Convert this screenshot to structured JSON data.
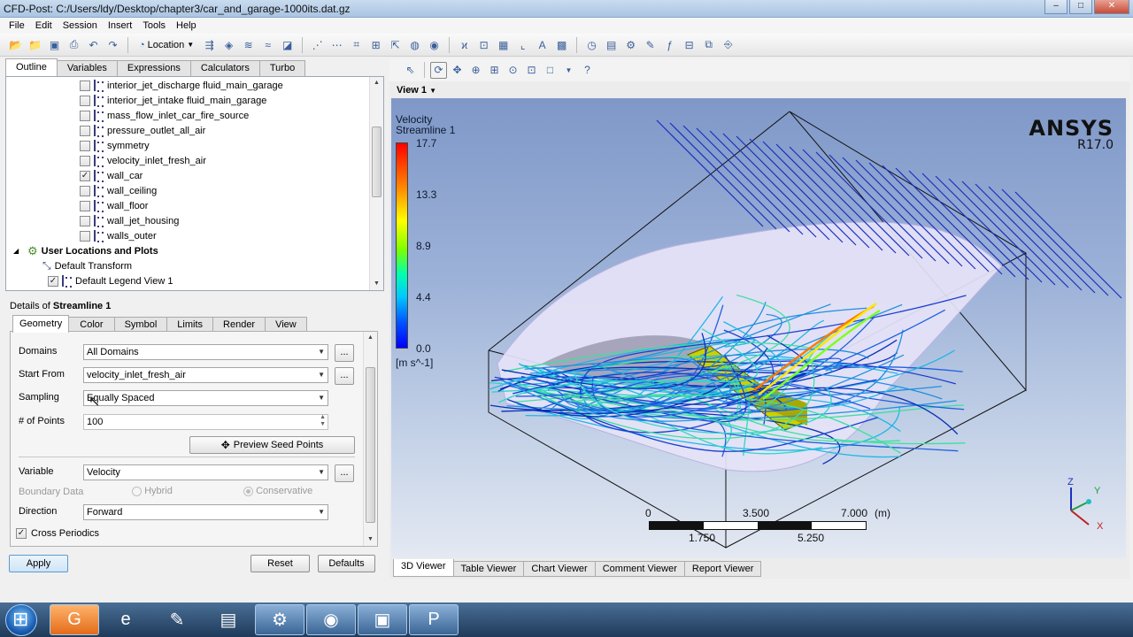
{
  "window": {
    "title": "CFD-Post: C:/Users/ldy/Desktop/chapter3/car_and_garage-1000its.dat.gz"
  },
  "menu": [
    "File",
    "Edit",
    "Session",
    "Insert",
    "Tools",
    "Help"
  ],
  "toolbar": {
    "location_label": "Location"
  },
  "outline_tabs": [
    "Outline",
    "Variables",
    "Expressions",
    "Calculators",
    "Turbo"
  ],
  "tree": {
    "boundaries": [
      {
        "label": "interior_jet_discharge fluid_main_garage",
        "checked": false
      },
      {
        "label": "interior_jet_intake fluid_main_garage",
        "checked": false
      },
      {
        "label": "mass_flow_inlet_car_fire_source",
        "checked": false
      },
      {
        "label": "pressure_outlet_all_air",
        "checked": false
      },
      {
        "label": "symmetry",
        "checked": false
      },
      {
        "label": "velocity_inlet_fresh_air",
        "checked": false
      },
      {
        "label": "wall_car",
        "checked": true
      },
      {
        "label": "wall_ceiling",
        "checked": false
      },
      {
        "label": "wall_floor",
        "checked": false
      },
      {
        "label": "wall_jet_housing",
        "checked": false
      },
      {
        "label": "walls_outer",
        "checked": false
      }
    ],
    "user_locations": "User Locations and Plots",
    "default_transform": "Default Transform",
    "default_legend": "Default Legend View 1"
  },
  "details": {
    "prefix": "Details of ",
    "object": "Streamline 1",
    "tabs": [
      "Geometry",
      "Color",
      "Symbol",
      "Limits",
      "Render",
      "View"
    ],
    "domains_label": "Domains",
    "domains_value": "All Domains",
    "start_from_label": "Start From",
    "start_from_value": "velocity_inlet_fresh_air",
    "sampling_label": "Sampling",
    "sampling_value": "Equally Spaced",
    "points_label": "# of Points",
    "points_value": "100",
    "preview_label": "Preview Seed Points",
    "variable_label": "Variable",
    "variable_value": "Velocity",
    "boundary_label": "Boundary Data",
    "hybrid_label": "Hybrid",
    "conservative_label": "Conservative",
    "direction_label": "Direction",
    "direction_value": "Forward",
    "cross_periodics_label": "Cross Periodics",
    "cross_periodics_checked": true,
    "dots": "..."
  },
  "buttons": {
    "apply": "Apply",
    "reset": "Reset",
    "defaults": "Defaults"
  },
  "viewer": {
    "view_name": "View 1",
    "legend_title_1": "Velocity",
    "legend_title_2": "Streamline 1",
    "legend_ticks": [
      "17.7",
      "13.3",
      "8.9",
      "4.4",
      "0.0"
    ],
    "legend_unit": "[m s^-1]",
    "brand": "ANSYS",
    "version": "R17.0",
    "scale_top": [
      "0",
      "3.500",
      "7.000",
      "(m)"
    ],
    "scale_bottom": [
      "1.750",
      "5.250"
    ],
    "axis_labels": [
      "Z",
      "Y",
      "X"
    ],
    "colors": {
      "low": "#0000ff",
      "mid": "#00ffb0",
      "high": "#ff0000",
      "car": "#ccd000",
      "geometry": "#e4e2f6"
    }
  },
  "viewer_tabs": [
    "3D Viewer",
    "Table Viewer",
    "Chart Viewer",
    "Comment Viewer",
    "Report Viewer"
  ],
  "taskbar_icons": [
    "foxit-pdf-icon",
    "internet-explorer-icon",
    "tool-icon",
    "file-explorer-icon",
    "ansys-workbench-icon",
    "cfd-post-icon",
    "app-icon",
    "powerpoint-icon"
  ]
}
